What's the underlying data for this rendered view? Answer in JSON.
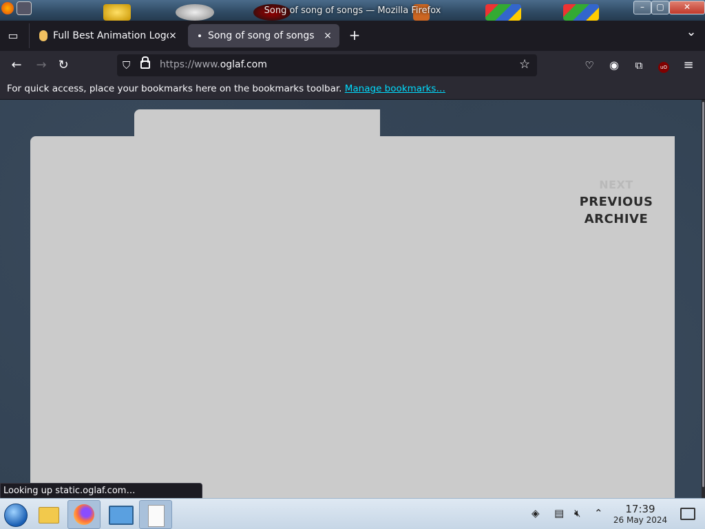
{
  "window": {
    "title": "Song of song of songs — Mozilla Firefox",
    "minimize": "–",
    "maximize": "▢",
    "close": "✕"
  },
  "tabs": [
    {
      "label": "Full Best Animation Logo",
      "close": "×"
    },
    {
      "label": "Song of song of songs",
      "close": "×"
    }
  ],
  "tabstrip": {
    "new_tab": "+",
    "list_all": "⌄"
  },
  "navbar": {
    "back": "←",
    "forward": "→",
    "reload": "↻",
    "url_prefix": "https://www.",
    "url_domain": "oglaf.com",
    "bookmark_star": "☆",
    "pocket": "♡",
    "account": "◉",
    "extensions": "⧉",
    "ublock": "uO",
    "menu": "≡"
  },
  "bookmarks_bar": {
    "message": "For quick access, place your bookmarks here on the bookmarks toolbar.",
    "link": "Manage bookmarks…"
  },
  "comic_nav": {
    "next": "NEXT",
    "previous": "PREVIOUS",
    "archive": "ARCHIVE"
  },
  "status_bar": "Looking up static.oglaf.com…",
  "taskbar": {
    "time": "17:39",
    "date": "26 May 2024"
  },
  "colors": {
    "accent_link": "#00ddff",
    "panel": "#cbcbcb",
    "tab_active": "#42414d"
  }
}
